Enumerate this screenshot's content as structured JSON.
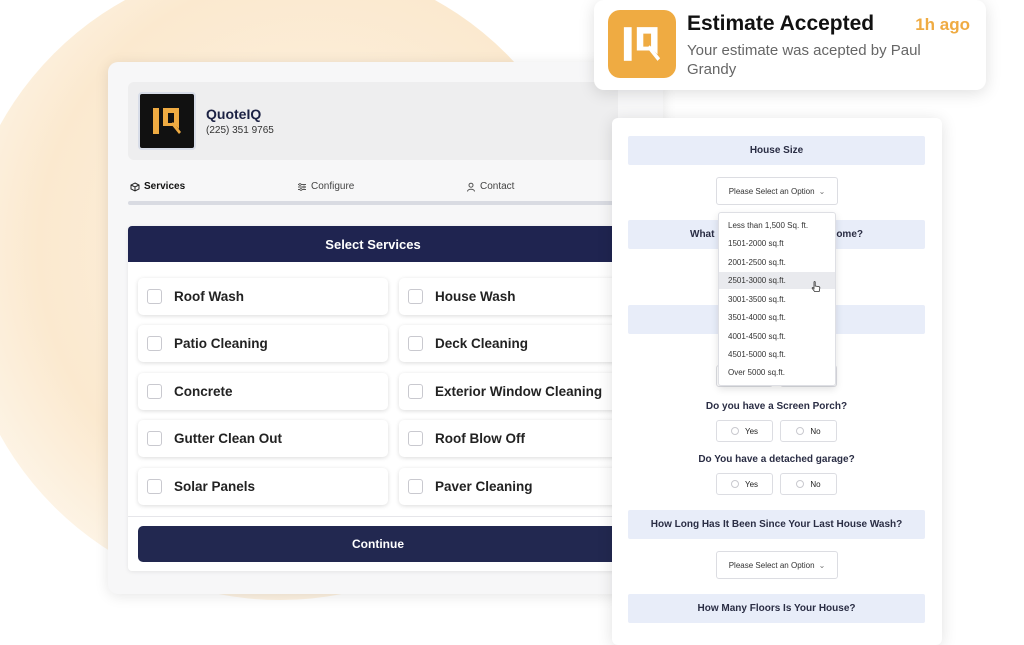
{
  "brand": {
    "name": "QuoteIQ",
    "phone": "(225) 351 9765"
  },
  "steps": [
    {
      "label": "Services",
      "icon": "cube-icon",
      "active": true
    },
    {
      "label": "Configure",
      "icon": "sliders-icon",
      "active": false
    },
    {
      "label": "Contact",
      "icon": "user-icon",
      "active": false
    }
  ],
  "select_services": {
    "title": "Select Services",
    "items": [
      "Roof Wash",
      "House Wash",
      "Patio Cleaning",
      "Deck Cleaning",
      "Concrete",
      "Exterior Window Cleaning",
      "Gutter Clean Out",
      "Roof Blow Off",
      "Solar Panels",
      "Paver Cleaning"
    ],
    "continue_label": "Continue"
  },
  "configure": {
    "house_size_label": "House Size",
    "select_placeholder": "Please Select an Option",
    "partial_question_left": "What",
    "partial_question_right": "ome?",
    "house_size_options": [
      "Less than 1,500 Sq. ft.",
      "1501-2000 sq.ft",
      "2001-2500 sq.ft.",
      "2501-3000 sq.ft.",
      "3001-3500 sq.ft.",
      "3501-4000 sq.ft.",
      "4001-4500 sq.ft.",
      "4501-5000 sq.ft.",
      "Over 5000 sq.ft."
    ],
    "highlighted_option": "2501-3000 sq.ft.",
    "screen_porch_q": "Do you have a Screen Porch?",
    "garage_q": "Do You have a detached garage?",
    "yes_label": "Yes",
    "no_label": "No",
    "last_wash_q": "How Long Has It Been Since Your Last House Wash?",
    "floors_q": "How Many Floors Is Your House?"
  },
  "notification": {
    "title": "Estimate Accepted",
    "time": "1h ago",
    "body": "Your estimate was acepted by Paul Grandy"
  },
  "colors": {
    "navy": "#1f2450",
    "accent": "#efab42",
    "question_bg": "#e8edf9"
  }
}
